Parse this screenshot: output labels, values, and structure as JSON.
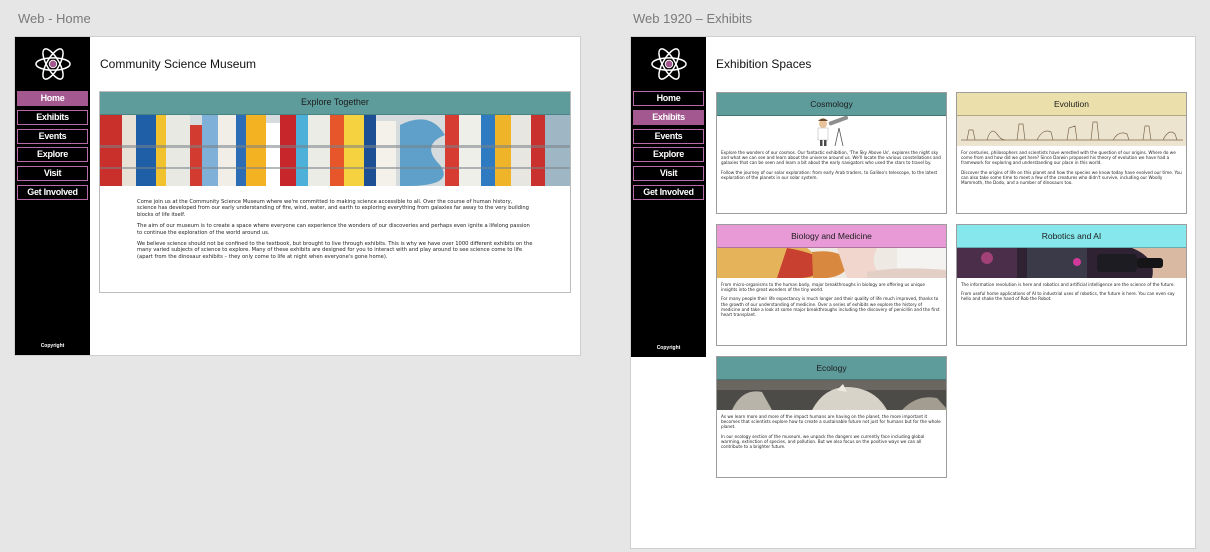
{
  "artboards": {
    "home_label": "Web - Home",
    "exhibits_label": "Web 1920 – Exhibits"
  },
  "nav": {
    "items": [
      "Home",
      "Exhibits",
      "Events",
      "Explore",
      "Visit",
      "Get Involved"
    ]
  },
  "copyright": "Copyright",
  "home": {
    "title": "Community Science Museum",
    "feature_heading": "Explore Together",
    "paragraphs": [
      "Come join us at the Community Science Museum where we're committed to making science accessible to all. Over the course of human history, science has developed from our early understanding of fire, wind, water, and earth to exploring everything from galaxies far away to the very building blocks of life itself.",
      "The aim of our museum is to create a space where everyone can experience the wonders of our discoveries and perhaps even ignite a lifelong passion to continue the exploration of the world around us.",
      "We believe science should not be confined to the textbook, but brought to live through exhibits. This is why we have over 1000 different exhibits on the many varied subjects of science to explore. Many of these exhibits are designed for you to interact with and play around to see science come to life (apart from the dinosaur exhibits – they only come to life at night when everyone's gone home)."
    ]
  },
  "exhibits": {
    "title": "Exhibition Spaces",
    "cards": [
      {
        "name": "Cosmology",
        "color": "#5e9b9b",
        "paragraphs": [
          "Explore the wonders of our cosmos. Our fantastic exhibition, 'The Sky Above Us', explores the night sky and what we can see and learn about the universe around us. We'll locate the various constellations and galaxies that can be seen and learn a bit about the early navigators who used the stars to travel by.",
          "Follow the journey of our solar exploration: from early Arab traders, to Galileo's telescope, to the latest exploration of the planets in our solar system."
        ]
      },
      {
        "name": "Evolution",
        "color": "#ebe0ab",
        "paragraphs": [
          "For centuries, philosophers and scientists have wrestled with the question of our origins. Where do we come from and how did we get here? Since Darwin proposed his theory of evolution we have had a framework for exploring and understanding our place in this world.",
          "Discover the origins of life on this planet and how the species we know today have evolved our time. You can also take some time to meet a few of the creatures who didn't survive, including our Woolly Mammoth, the Dodo, and a number of dinosaurs too."
        ]
      },
      {
        "name": "Biology and Medicine",
        "color": "#e89ad6",
        "paragraphs": [
          "From micro-organisms to the human body, major breakthroughs in biology are offering us unique insights into the great wonders of the tiny world.",
          "For many people their life expectancy is much longer and their quality of life much improved, thanks to the growth of our understanding of medicine. Over a series of exhibits we explore the history of medicine and take a look at some major breakthroughs including the discovery of penicillin and the first heart transplant."
        ]
      },
      {
        "name": "Robotics and AI",
        "color": "#86e8ec",
        "paragraphs": [
          "The information revolution is here and robotics and artificial intelligence are the science of the future.",
          "From useful home applications of AI to industrial uses of robotics, the future is here. You can even say hello and shake the hand of Rob the Robot."
        ]
      },
      {
        "name": "Ecology",
        "color": "#5e9b9b",
        "paragraphs": [
          "As we learn more and more of the impact humans are having on the planet, the more important it becomes that scientists explore how to create a sustainable future not just for humans but for the whole planet.",
          "In our ecology section of the museum, we unpack the dangers we currently face including global warming, extinction of species, and pollution. But we also focus on the positive ways we can all contribute to a brighter future."
        ]
      }
    ]
  }
}
